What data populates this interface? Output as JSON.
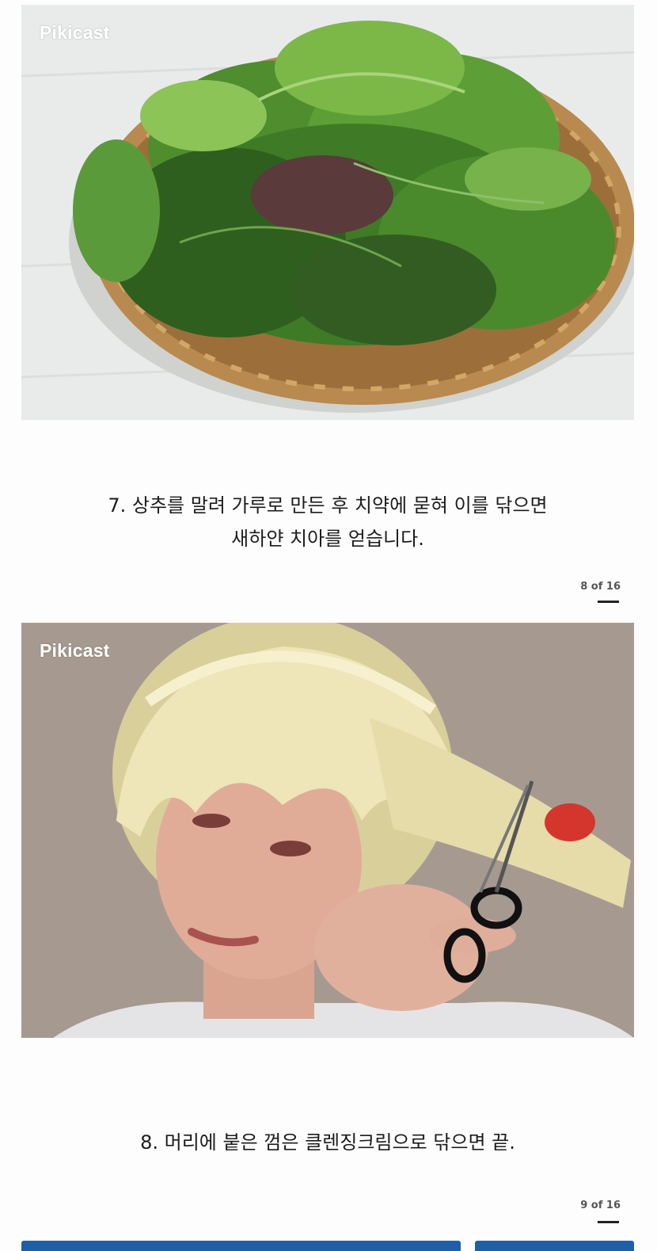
{
  "slides": [
    {
      "watermark": "Pikicast",
      "image_subject": "lettuce-basket-photo",
      "caption_line1": "7. 상추를 말려 가루로 만든 후 치약에 묻혀 이를 닦으면",
      "caption_line2": "새하얀 치아를 얻습니다.",
      "counter": "8 of 16"
    },
    {
      "watermark": "Pikicast",
      "image_subject": "blonde-hair-scissors-photo",
      "caption_line1": "8. 머리에 붙은 껌은 클렌징크림으로 닦으면 끝.",
      "counter": "9 of 16"
    }
  ],
  "colors": {
    "bottom_tab": "#1f5fa8",
    "caption_text": "#1c1c1c",
    "counter_text": "#555555"
  }
}
